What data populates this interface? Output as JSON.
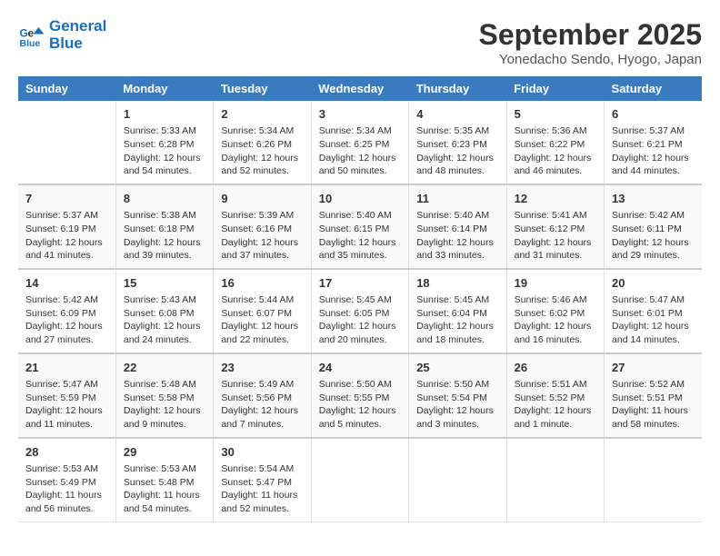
{
  "logo": {
    "line1": "General",
    "line2": "Blue"
  },
  "title": "September 2025",
  "location": "Yonedacho Sendo, Hyogo, Japan",
  "weekdays": [
    "Sunday",
    "Monday",
    "Tuesday",
    "Wednesday",
    "Thursday",
    "Friday",
    "Saturday"
  ],
  "weeks": [
    [
      {
        "day": "",
        "sunrise": "",
        "sunset": "",
        "daylight": ""
      },
      {
        "day": "1",
        "sunrise": "Sunrise: 5:33 AM",
        "sunset": "Sunset: 6:28 PM",
        "daylight": "Daylight: 12 hours and 54 minutes."
      },
      {
        "day": "2",
        "sunrise": "Sunrise: 5:34 AM",
        "sunset": "Sunset: 6:26 PM",
        "daylight": "Daylight: 12 hours and 52 minutes."
      },
      {
        "day": "3",
        "sunrise": "Sunrise: 5:34 AM",
        "sunset": "Sunset: 6:25 PM",
        "daylight": "Daylight: 12 hours and 50 minutes."
      },
      {
        "day": "4",
        "sunrise": "Sunrise: 5:35 AM",
        "sunset": "Sunset: 6:23 PM",
        "daylight": "Daylight: 12 hours and 48 minutes."
      },
      {
        "day": "5",
        "sunrise": "Sunrise: 5:36 AM",
        "sunset": "Sunset: 6:22 PM",
        "daylight": "Daylight: 12 hours and 46 minutes."
      },
      {
        "day": "6",
        "sunrise": "Sunrise: 5:37 AM",
        "sunset": "Sunset: 6:21 PM",
        "daylight": "Daylight: 12 hours and 44 minutes."
      }
    ],
    [
      {
        "day": "7",
        "sunrise": "Sunrise: 5:37 AM",
        "sunset": "Sunset: 6:19 PM",
        "daylight": "Daylight: 12 hours and 41 minutes."
      },
      {
        "day": "8",
        "sunrise": "Sunrise: 5:38 AM",
        "sunset": "Sunset: 6:18 PM",
        "daylight": "Daylight: 12 hours and 39 minutes."
      },
      {
        "day": "9",
        "sunrise": "Sunrise: 5:39 AM",
        "sunset": "Sunset: 6:16 PM",
        "daylight": "Daylight: 12 hours and 37 minutes."
      },
      {
        "day": "10",
        "sunrise": "Sunrise: 5:40 AM",
        "sunset": "Sunset: 6:15 PM",
        "daylight": "Daylight: 12 hours and 35 minutes."
      },
      {
        "day": "11",
        "sunrise": "Sunrise: 5:40 AM",
        "sunset": "Sunset: 6:14 PM",
        "daylight": "Daylight: 12 hours and 33 minutes."
      },
      {
        "day": "12",
        "sunrise": "Sunrise: 5:41 AM",
        "sunset": "Sunset: 6:12 PM",
        "daylight": "Daylight: 12 hours and 31 minutes."
      },
      {
        "day": "13",
        "sunrise": "Sunrise: 5:42 AM",
        "sunset": "Sunset: 6:11 PM",
        "daylight": "Daylight: 12 hours and 29 minutes."
      }
    ],
    [
      {
        "day": "14",
        "sunrise": "Sunrise: 5:42 AM",
        "sunset": "Sunset: 6:09 PM",
        "daylight": "Daylight: 12 hours and 27 minutes."
      },
      {
        "day": "15",
        "sunrise": "Sunrise: 5:43 AM",
        "sunset": "Sunset: 6:08 PM",
        "daylight": "Daylight: 12 hours and 24 minutes."
      },
      {
        "day": "16",
        "sunrise": "Sunrise: 5:44 AM",
        "sunset": "Sunset: 6:07 PM",
        "daylight": "Daylight: 12 hours and 22 minutes."
      },
      {
        "day": "17",
        "sunrise": "Sunrise: 5:45 AM",
        "sunset": "Sunset: 6:05 PM",
        "daylight": "Daylight: 12 hours and 20 minutes."
      },
      {
        "day": "18",
        "sunrise": "Sunrise: 5:45 AM",
        "sunset": "Sunset: 6:04 PM",
        "daylight": "Daylight: 12 hours and 18 minutes."
      },
      {
        "day": "19",
        "sunrise": "Sunrise: 5:46 AM",
        "sunset": "Sunset: 6:02 PM",
        "daylight": "Daylight: 12 hours and 16 minutes."
      },
      {
        "day": "20",
        "sunrise": "Sunrise: 5:47 AM",
        "sunset": "Sunset: 6:01 PM",
        "daylight": "Daylight: 12 hours and 14 minutes."
      }
    ],
    [
      {
        "day": "21",
        "sunrise": "Sunrise: 5:47 AM",
        "sunset": "Sunset: 5:59 PM",
        "daylight": "Daylight: 12 hours and 11 minutes."
      },
      {
        "day": "22",
        "sunrise": "Sunrise: 5:48 AM",
        "sunset": "Sunset: 5:58 PM",
        "daylight": "Daylight: 12 hours and 9 minutes."
      },
      {
        "day": "23",
        "sunrise": "Sunrise: 5:49 AM",
        "sunset": "Sunset: 5:56 PM",
        "daylight": "Daylight: 12 hours and 7 minutes."
      },
      {
        "day": "24",
        "sunrise": "Sunrise: 5:50 AM",
        "sunset": "Sunset: 5:55 PM",
        "daylight": "Daylight: 12 hours and 5 minutes."
      },
      {
        "day": "25",
        "sunrise": "Sunrise: 5:50 AM",
        "sunset": "Sunset: 5:54 PM",
        "daylight": "Daylight: 12 hours and 3 minutes."
      },
      {
        "day": "26",
        "sunrise": "Sunrise: 5:51 AM",
        "sunset": "Sunset: 5:52 PM",
        "daylight": "Daylight: 12 hours and 1 minute."
      },
      {
        "day": "27",
        "sunrise": "Sunrise: 5:52 AM",
        "sunset": "Sunset: 5:51 PM",
        "daylight": "Daylight: 11 hours and 58 minutes."
      }
    ],
    [
      {
        "day": "28",
        "sunrise": "Sunrise: 5:53 AM",
        "sunset": "Sunset: 5:49 PM",
        "daylight": "Daylight: 11 hours and 56 minutes."
      },
      {
        "day": "29",
        "sunrise": "Sunrise: 5:53 AM",
        "sunset": "Sunset: 5:48 PM",
        "daylight": "Daylight: 11 hours and 54 minutes."
      },
      {
        "day": "30",
        "sunrise": "Sunrise: 5:54 AM",
        "sunset": "Sunset: 5:47 PM",
        "daylight": "Daylight: 11 hours and 52 minutes."
      },
      {
        "day": "",
        "sunrise": "",
        "sunset": "",
        "daylight": ""
      },
      {
        "day": "",
        "sunrise": "",
        "sunset": "",
        "daylight": ""
      },
      {
        "day": "",
        "sunrise": "",
        "sunset": "",
        "daylight": ""
      },
      {
        "day": "",
        "sunrise": "",
        "sunset": "",
        "daylight": ""
      }
    ]
  ]
}
